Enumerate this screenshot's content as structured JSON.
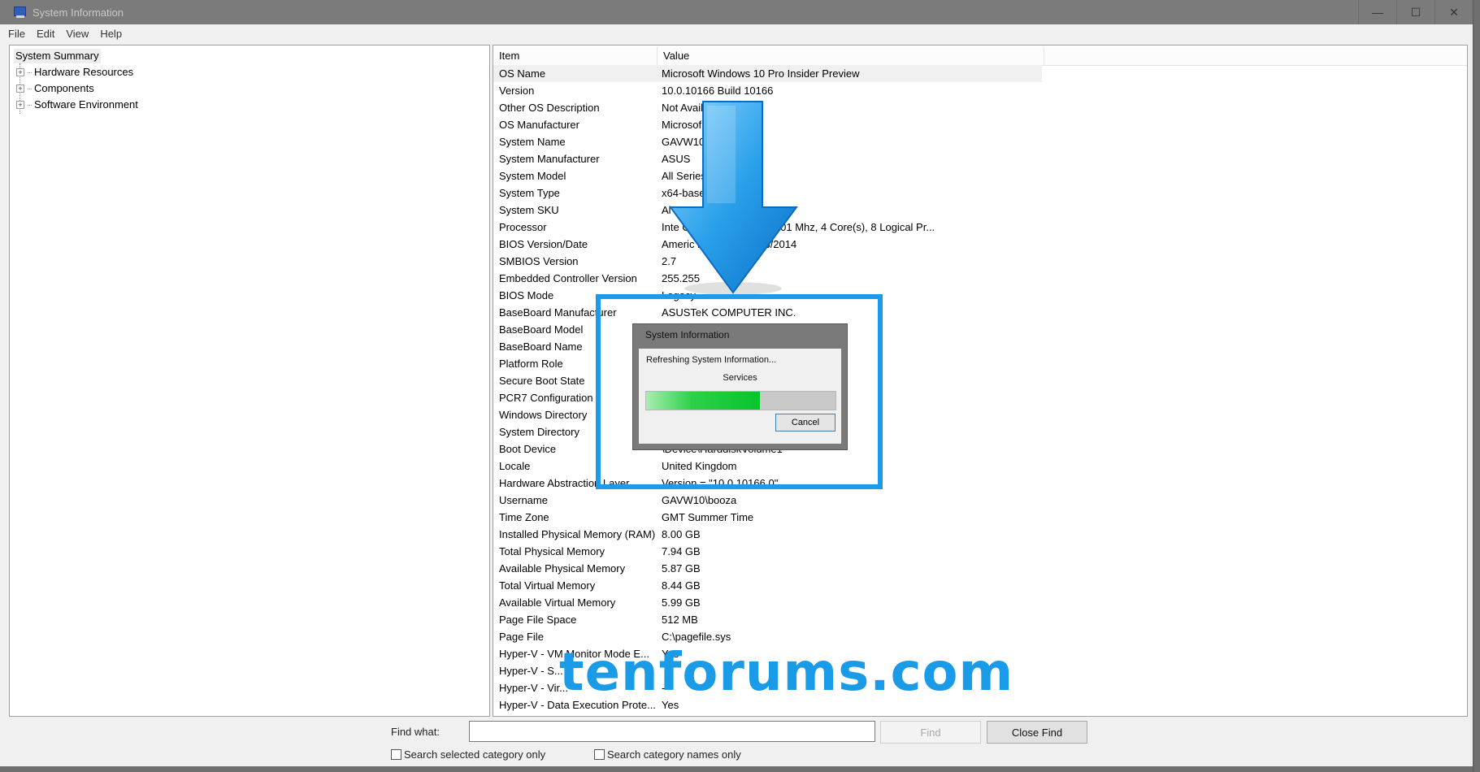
{
  "window": {
    "title": "System Information",
    "controls": [
      "minimize-icon",
      "maximize-icon",
      "close-icon"
    ],
    "control_glyphs": [
      "—",
      "☐",
      "✕"
    ]
  },
  "menu": [
    "File",
    "Edit",
    "View",
    "Help"
  ],
  "tree": {
    "root": "System Summary",
    "nodes": [
      "Hardware Resources",
      "Components",
      "Software Environment"
    ]
  },
  "list": {
    "columns": [
      "Item",
      "Value"
    ],
    "rows": [
      {
        "item": "OS Name",
        "value": "Microsoft Windows 10 Pro Insider Preview"
      },
      {
        "item": "Version",
        "value": "10.0.10166 Build 10166"
      },
      {
        "item": "Other OS Description",
        "value": "Not Avail"
      },
      {
        "item": "OS Manufacturer",
        "value": "Microsof                n"
      },
      {
        "item": "System Name",
        "value": "GAVW10"
      },
      {
        "item": "System Manufacturer",
        "value": "ASUS"
      },
      {
        "item": "System Model",
        "value": "All Series"
      },
      {
        "item": "System Type",
        "value": "x64-base"
      },
      {
        "item": "System SKU",
        "value": "Al"
      },
      {
        "item": "Processor",
        "value": "Inte                              CPU @ 4.00GHz, 4001 Mhz, 4 Core(s), 8 Logical Pr..."
      },
      {
        "item": "BIOS Version/Date",
        "value": "Americ                        nc. 2004, 03/06/2014"
      },
      {
        "item": "SMBIOS Version",
        "value": "2.7"
      },
      {
        "item": "Embedded Controller Version",
        "value": "255.255"
      },
      {
        "item": "BIOS Mode",
        "value": "Legacy"
      },
      {
        "item": "BaseBoard Manufacturer",
        "value": "ASUSTeK COMPUTER INC."
      },
      {
        "item": "BaseBoard Model",
        "value": ""
      },
      {
        "item": "BaseBoard Name",
        "value": ""
      },
      {
        "item": "Platform Role",
        "value": ""
      },
      {
        "item": "Secure Boot State",
        "value": ""
      },
      {
        "item": "PCR7 Configuration",
        "value": ""
      },
      {
        "item": "Windows Directory",
        "value": ""
      },
      {
        "item": "System Directory",
        "value": ""
      },
      {
        "item": "Boot Device",
        "value": "\\Device\\HarddiskVolume1"
      },
      {
        "item": "Locale",
        "value": "United Kingdom"
      },
      {
        "item": "Hardware Abstraction Layer",
        "value": "Version = \"10.0.10166.0\""
      },
      {
        "item": "Username",
        "value": "GAVW10\\booza"
      },
      {
        "item": "Time Zone",
        "value": "GMT Summer Time"
      },
      {
        "item": "Installed Physical Memory (RAM)",
        "value": "8.00 GB"
      },
      {
        "item": "Total Physical Memory",
        "value": "7.94 GB"
      },
      {
        "item": "Available Physical Memory",
        "value": "5.87 GB"
      },
      {
        "item": "Total Virtual Memory",
        "value": "8.44 GB"
      },
      {
        "item": "Available Virtual Memory",
        "value": "5.99 GB"
      },
      {
        "item": "Page File Space",
        "value": "512 MB"
      },
      {
        "item": "Page File",
        "value": "C:\\pagefile.sys"
      },
      {
        "item": "Hyper-V - VM Monitor Mode E...",
        "value": "Yes"
      },
      {
        "item": "Hyper-V - S...",
        "value": ""
      },
      {
        "item": "Hyper-V - Vir...",
        "value": "-"
      },
      {
        "item": "Hyper-V - Data Execution Prote...",
        "value": "Yes"
      }
    ]
  },
  "find": {
    "label": "Find what:",
    "value": "",
    "find_button": "Find",
    "close_button": "Close Find",
    "checkbox_selected_category": "Search selected category only",
    "checkbox_category_names": "Search category names only"
  },
  "dialog": {
    "title": "System Information",
    "message": "Refreshing System Information...",
    "current_item": "Services",
    "progress_percent": 60,
    "cancel_label": "Cancel"
  },
  "annotation": {
    "watermark": "tenforums.com",
    "accent_color": "#1e9be8"
  }
}
